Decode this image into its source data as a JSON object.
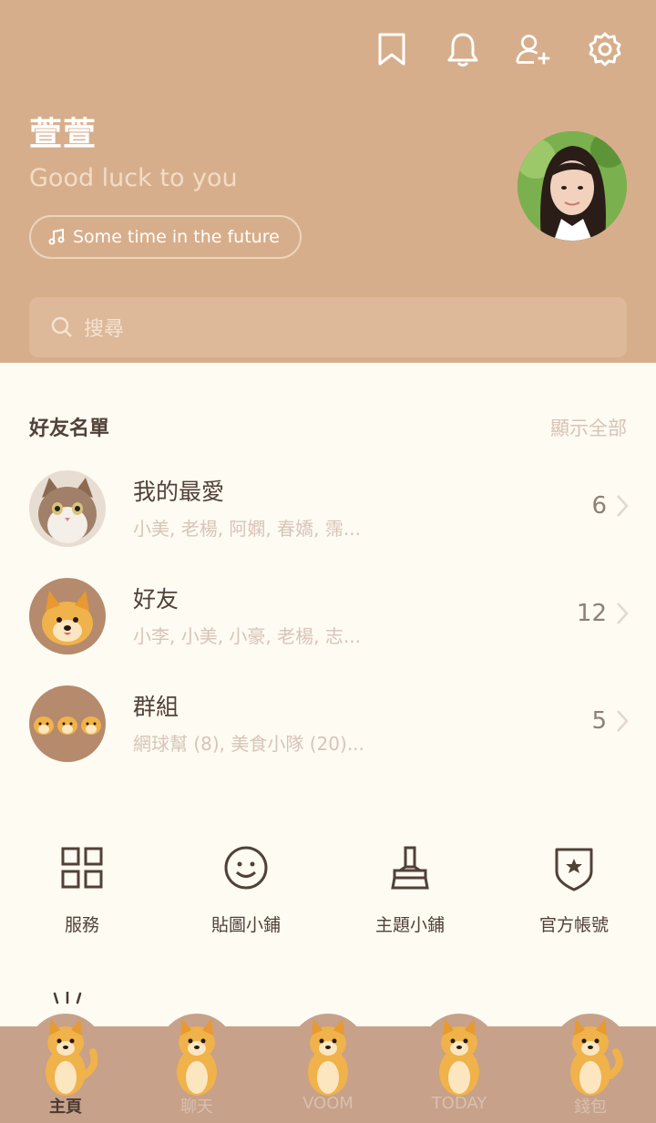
{
  "colors": {
    "header_bg": "#d7ae8b",
    "body_bg": "#fdfbf2",
    "nav_bg": "#c7a189",
    "text_dark": "#514138",
    "text_muted": "#d8c3b5"
  },
  "header": {
    "icons": [
      "bookmark-icon",
      "bell-icon",
      "add-friend-icon",
      "settings-icon"
    ],
    "name": "萱萱",
    "status": "Good luck to you",
    "music": "Some time in the future"
  },
  "search": {
    "placeholder": "搜尋"
  },
  "friends": {
    "title": "好友名單",
    "show_all": "顯示全部",
    "rows": [
      {
        "title": "我的最愛",
        "subtitle": "小美, 老楊, 阿嫻, 春嬌, 霈...",
        "count": "6"
      },
      {
        "title": "好友",
        "subtitle": "小李, 小美, 小豪, 老楊, 志...",
        "count": "12"
      },
      {
        "title": "群組",
        "subtitle": "網球幫 (8), 美食小隊 (20)...",
        "count": "5"
      }
    ]
  },
  "features": [
    {
      "label": "服務",
      "icon": "grid-icon"
    },
    {
      "label": "貼圖小鋪",
      "icon": "smiley-icon"
    },
    {
      "label": "主題小鋪",
      "icon": "brush-icon"
    },
    {
      "label": "官方帳號",
      "icon": "shield-star-icon"
    }
  ],
  "nav": [
    {
      "label": "主頁",
      "active": true
    },
    {
      "label": "聊天",
      "active": false
    },
    {
      "label": "VOOM",
      "active": false
    },
    {
      "label": "TODAY",
      "active": false
    },
    {
      "label": "錢包",
      "active": false
    }
  ]
}
